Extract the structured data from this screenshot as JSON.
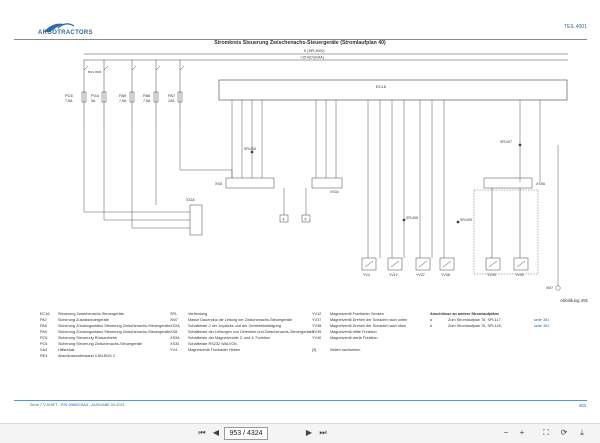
{
  "header": {
    "logo_text": "ARGOTRACTORS",
    "page_id": "TEIL 4001"
  },
  "title": "Stromkreis Steuerung Zwischenachs-Steuergeräte (Stromlaufplan 40)",
  "diagram": {
    "bus_top": "K (SPL3000)",
    "bus_bottom": "+15 KEY(KAA)",
    "ecu_label": "EC16",
    "fuses": [
      {
        "id": "PC6",
        "rating": "7,5A"
      },
      {
        "id": "PG4",
        "rating": "5A"
      },
      {
        "id": "PA9",
        "rating": "7,5A"
      },
      {
        "id": "PA6",
        "rating": "7,5A"
      },
      {
        "id": "PA7",
        "rating": "10A"
      }
    ],
    "relay_label": "BUS RMF",
    "splice_labels": [
      "SPL006",
      "SPL008",
      "SPL009",
      "SPL007"
    ],
    "connector_labels": [
      "X32A",
      "XS8",
      "XS34",
      "XS9A",
      "XM7"
    ],
    "ground_labels": [
      "4",
      "5"
    ],
    "valves": [
      "YV4",
      "YV12",
      "YV37",
      "YV38",
      "YV39",
      "YV40"
    ],
    "figure_label": "Abbildung 491"
  },
  "legend": {
    "col1": [
      {
        "code": "EC16",
        "desc": "Steuerung Zwischenachs-Steuergeräte"
      },
      {
        "code": "PA7",
        "desc": "Sicherung Zusatzsteuergeräte"
      },
      {
        "code": "PA6",
        "desc": "Sicherung Zündungsstatus Steuerung Zwischenachs-Steuergeräte"
      },
      {
        "code": "PA9",
        "desc": "Sicherung Zündungsstatus Steuerung Zwischenachs-Steuergeräte"
      },
      {
        "code": "PC6",
        "desc": "Sicherung Steuerung Rückantriebe"
      },
      {
        "code": "PC5",
        "desc": "Sicherung Steuerung Zwischenachs-Steuergeräte"
      },
      {
        "code": "XA4",
        "desc": "Hilfsrelais"
      },
      {
        "code": "RE4",
        "desc": "Abschlusswiderstand CAN-BUS 2"
      }
    ],
    "col2": [
      {
        "code": "SPL",
        "desc": "Verbindung"
      },
      {
        "code": "XM7",
        "desc": "Masse Dauerplus die Leitung der Zwischenachs-Steuergeräte"
      },
      {
        "code": "XS2A",
        "desc": "Schaltleiste 2 der Joysticks und der Getriebebetätigung"
      },
      {
        "code": "XS8",
        "desc": "Schaltleiste der Leitungen von Gelenken und Zwischenachs-Steuergeräten"
      },
      {
        "code": "XS9A",
        "desc": "Schaltleiste der Magnetventile 3. und 4. Funktion"
      },
      {
        "code": "XS34",
        "desc": "Schaltleiste RS232 WALVOIL"
      },
      {
        "code": "YV4",
        "desc": "Magnetventil Frontlader Heben"
      }
    ],
    "col3": [
      {
        "code": "YV12",
        "desc": "Magnetventil Frontlader Senken"
      },
      {
        "code": "YV37",
        "desc": "Magnetventil Drehen der Schaufel nach unten"
      },
      {
        "code": "YV38",
        "desc": "Magnetventil Drehen der Schaufel nach oben"
      },
      {
        "code": "YV39",
        "desc": "Magnetventil dritte Funktion"
      },
      {
        "code": "YV40",
        "desc": "Magnetventil vierte Funktion"
      },
      {
        "code": "[3]",
        "desc": "Seiten nachsehen"
      }
    ],
    "col4_title": "Anschlüsse an andere Stromlaufpläne",
    "col4": [
      {
        "code": "a",
        "desc": "Zum Stromlaufplan 76, SPL117,",
        "link": "seite 361"
      },
      {
        "code": "b",
        "desc": "Zum Stromlaufplan 76, SPL118,",
        "link": "seite 361"
      }
    ]
  },
  "footer": {
    "left": "Serie 7 V-SHIFT - P/N 998607AA3 - AUSGABE 04-2021",
    "right": "403"
  },
  "viewer": {
    "page_input": "953 / 4324",
    "first": "⏮",
    "prev": "◀",
    "next": "▶",
    "last": "⏭",
    "zoom_out": "−",
    "zoom_in": "+",
    "fit": "⛶",
    "rotate": "⟳",
    "download": "⤓"
  },
  "colors": {
    "accent": "#2b6aa6",
    "wire": "#444444"
  }
}
